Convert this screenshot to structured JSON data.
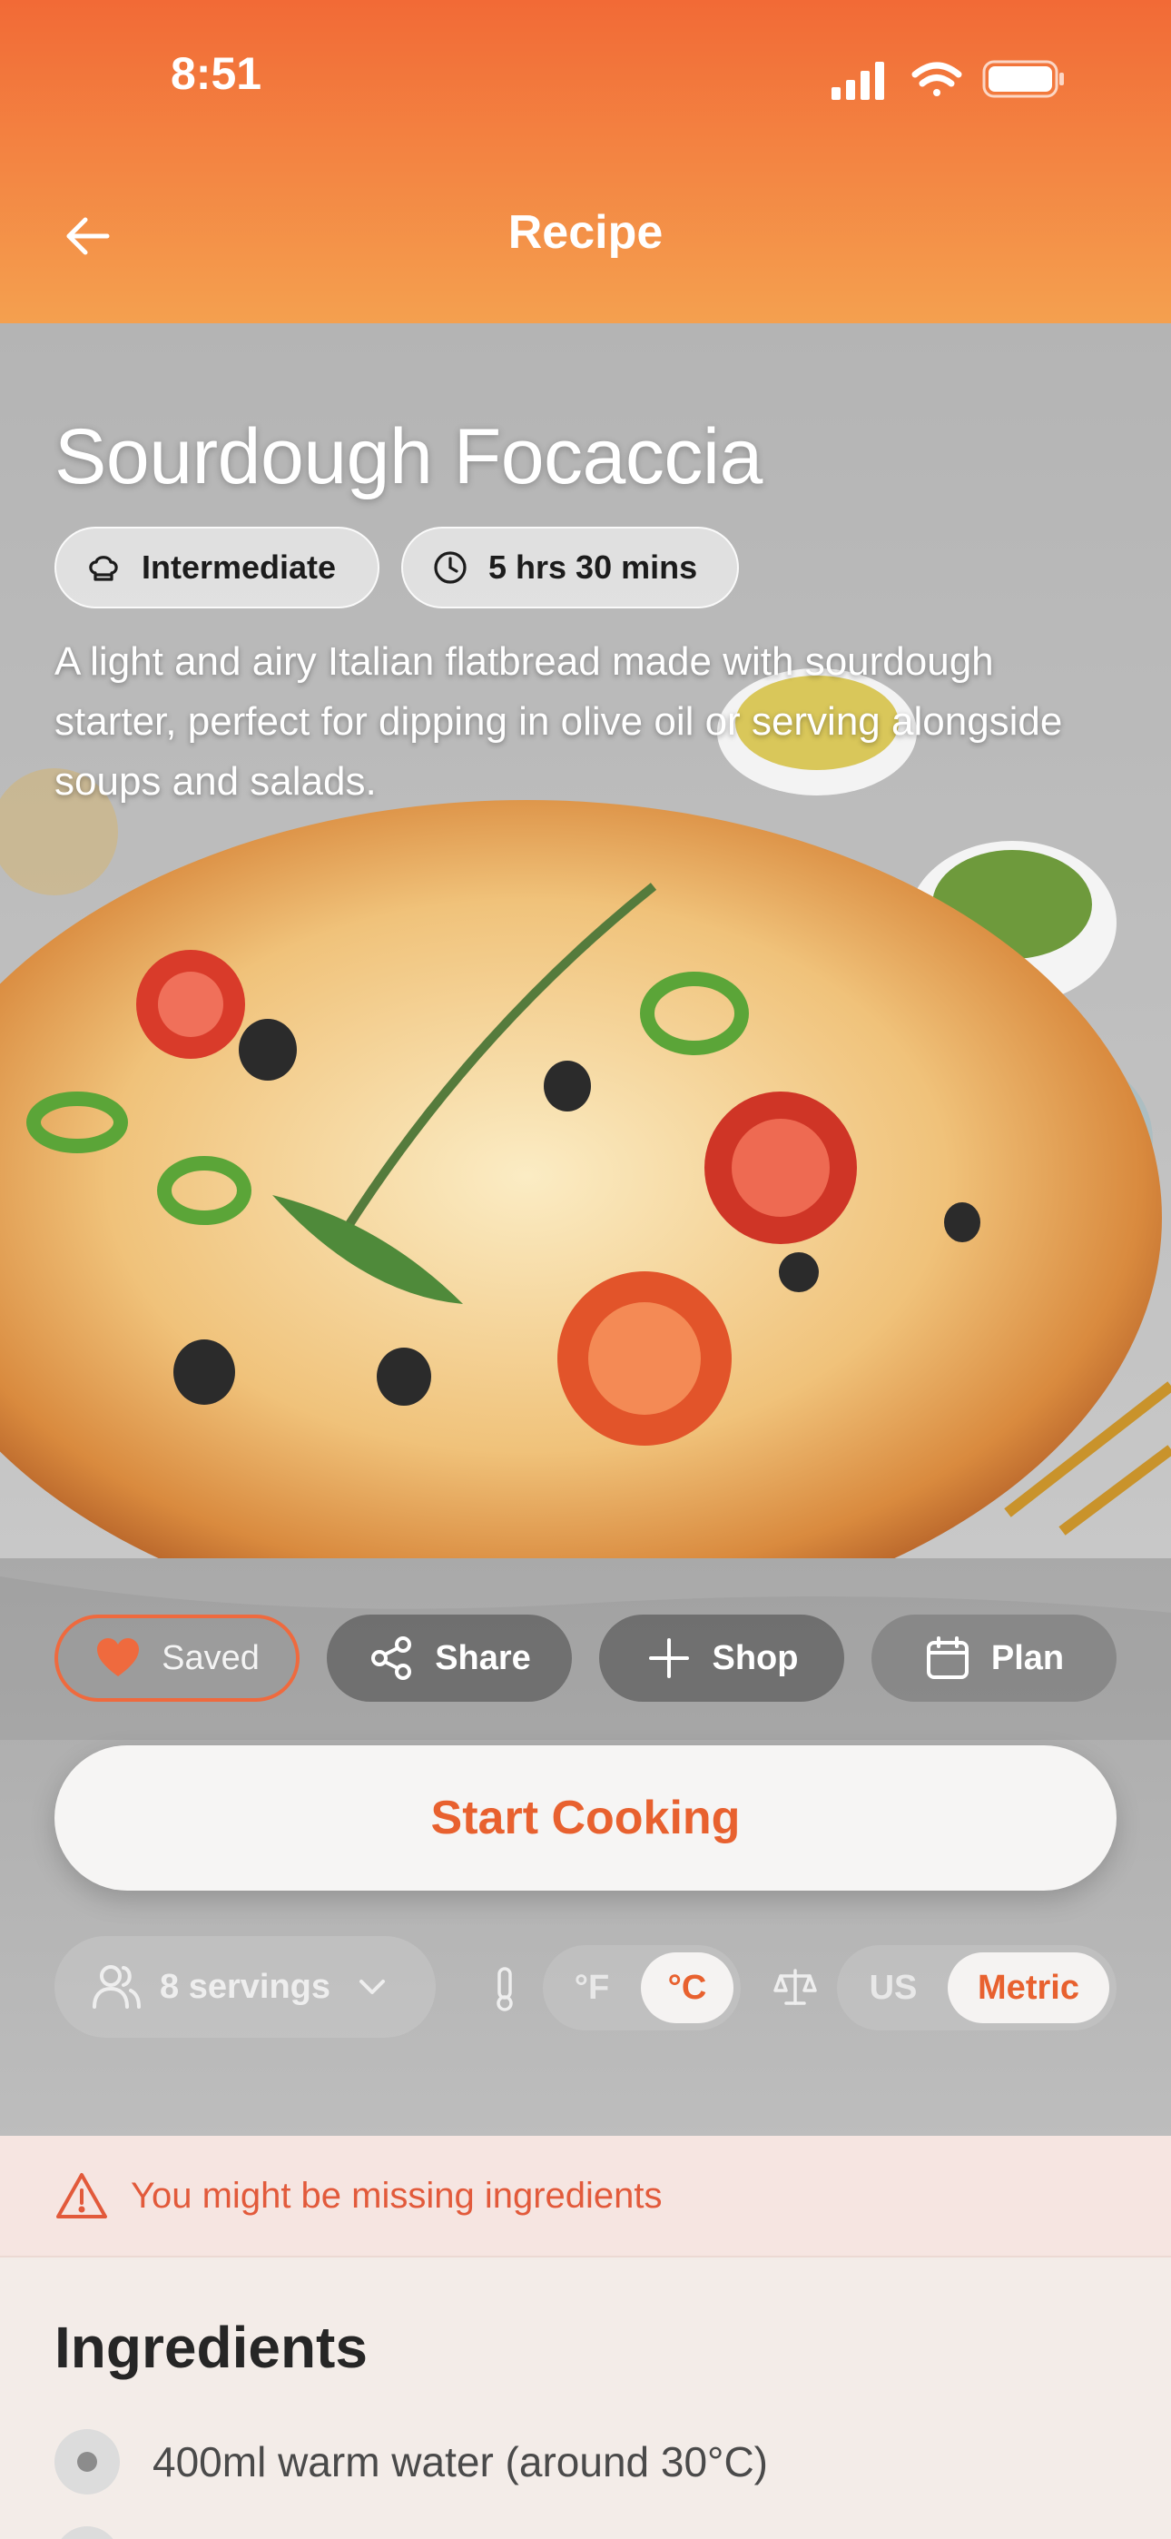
{
  "status_bar": {
    "time": "8:51",
    "icons": [
      "signal-icon",
      "wifi-icon",
      "battery-icon"
    ]
  },
  "nav": {
    "title": "Recipe",
    "back_icon": "arrow-left-icon"
  },
  "recipe": {
    "title": "Sourdough Focaccia",
    "difficulty": "Intermediate",
    "difficulty_icon": "chef-hat-icon",
    "time": "5 hrs 30 mins",
    "time_icon": "clock-icon",
    "description": "A light and airy Italian flatbread made with sourdough starter, perfect for dipping in olive oil or serving alongside soups and salads."
  },
  "actions": {
    "saved": "Saved",
    "share": "Share",
    "shop": "Shop",
    "plan": "Plan"
  },
  "start_cooking": "Start Cooking",
  "options": {
    "servings": "8 servings",
    "temperature": {
      "options": [
        "°F",
        "°C"
      ],
      "selected": "°C"
    },
    "units": {
      "options": [
        "US",
        "Metric"
      ],
      "selected": "Metric"
    }
  },
  "warning": "You might be missing ingredients",
  "ingredients": {
    "title": "Ingredients",
    "items": [
      "400ml warm water (around 30°C)"
    ]
  },
  "colors": {
    "accent": "#e8612f",
    "header_top": "#f26a36",
    "header_bottom": "#f4a04f",
    "warning_bg": "#f6e5e1"
  }
}
